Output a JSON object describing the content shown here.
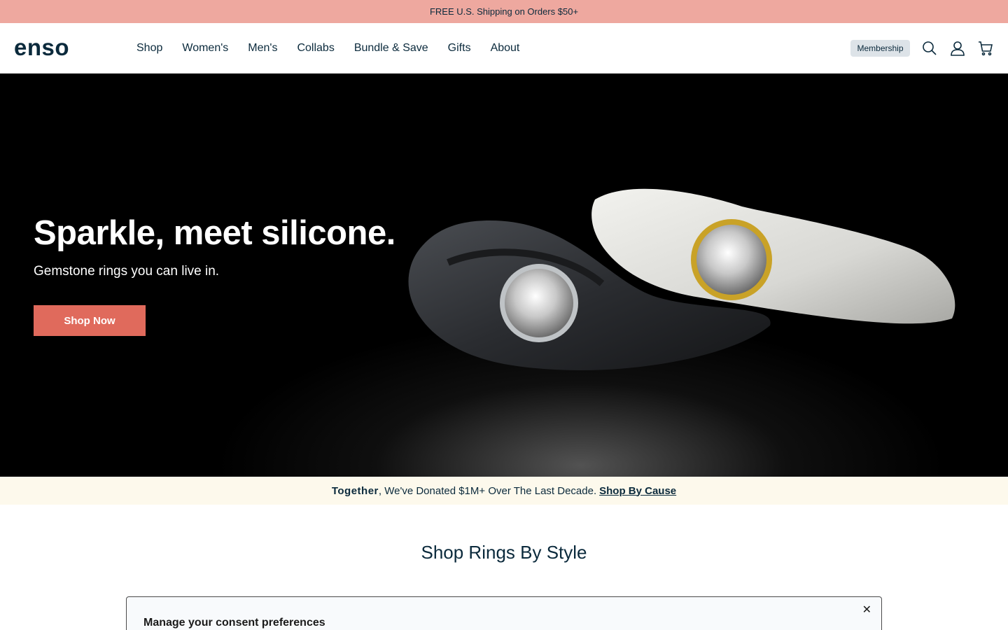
{
  "announcement": {
    "text": "FREE U.S. Shipping on Orders $50+"
  },
  "header": {
    "logo": "enso",
    "nav": [
      "Shop",
      "Women's",
      "Men's",
      "Collabs",
      "Bundle & Save",
      "Gifts",
      "About"
    ],
    "membership_label": "Membership",
    "icons": [
      "search-icon",
      "account-icon",
      "cart-icon"
    ]
  },
  "hero": {
    "title": "Sparkle, meet silicone.",
    "subtitle": "Gemstone rings you can live in.",
    "cta_label": "Shop Now"
  },
  "donation_banner": {
    "bold": "Together",
    "text": ", We've Donated $1M+ Over The Last Decade.",
    "link": "Shop By Cause"
  },
  "section": {
    "title": "Shop Rings By Style"
  },
  "consent": {
    "title": "Manage your consent preferences",
    "close": "✕"
  },
  "colors": {
    "accent": "#e06a5c",
    "announce_bg": "#eea89f",
    "brand_text": "#0b2a3c",
    "donate_bg": "#fdf9ec"
  }
}
